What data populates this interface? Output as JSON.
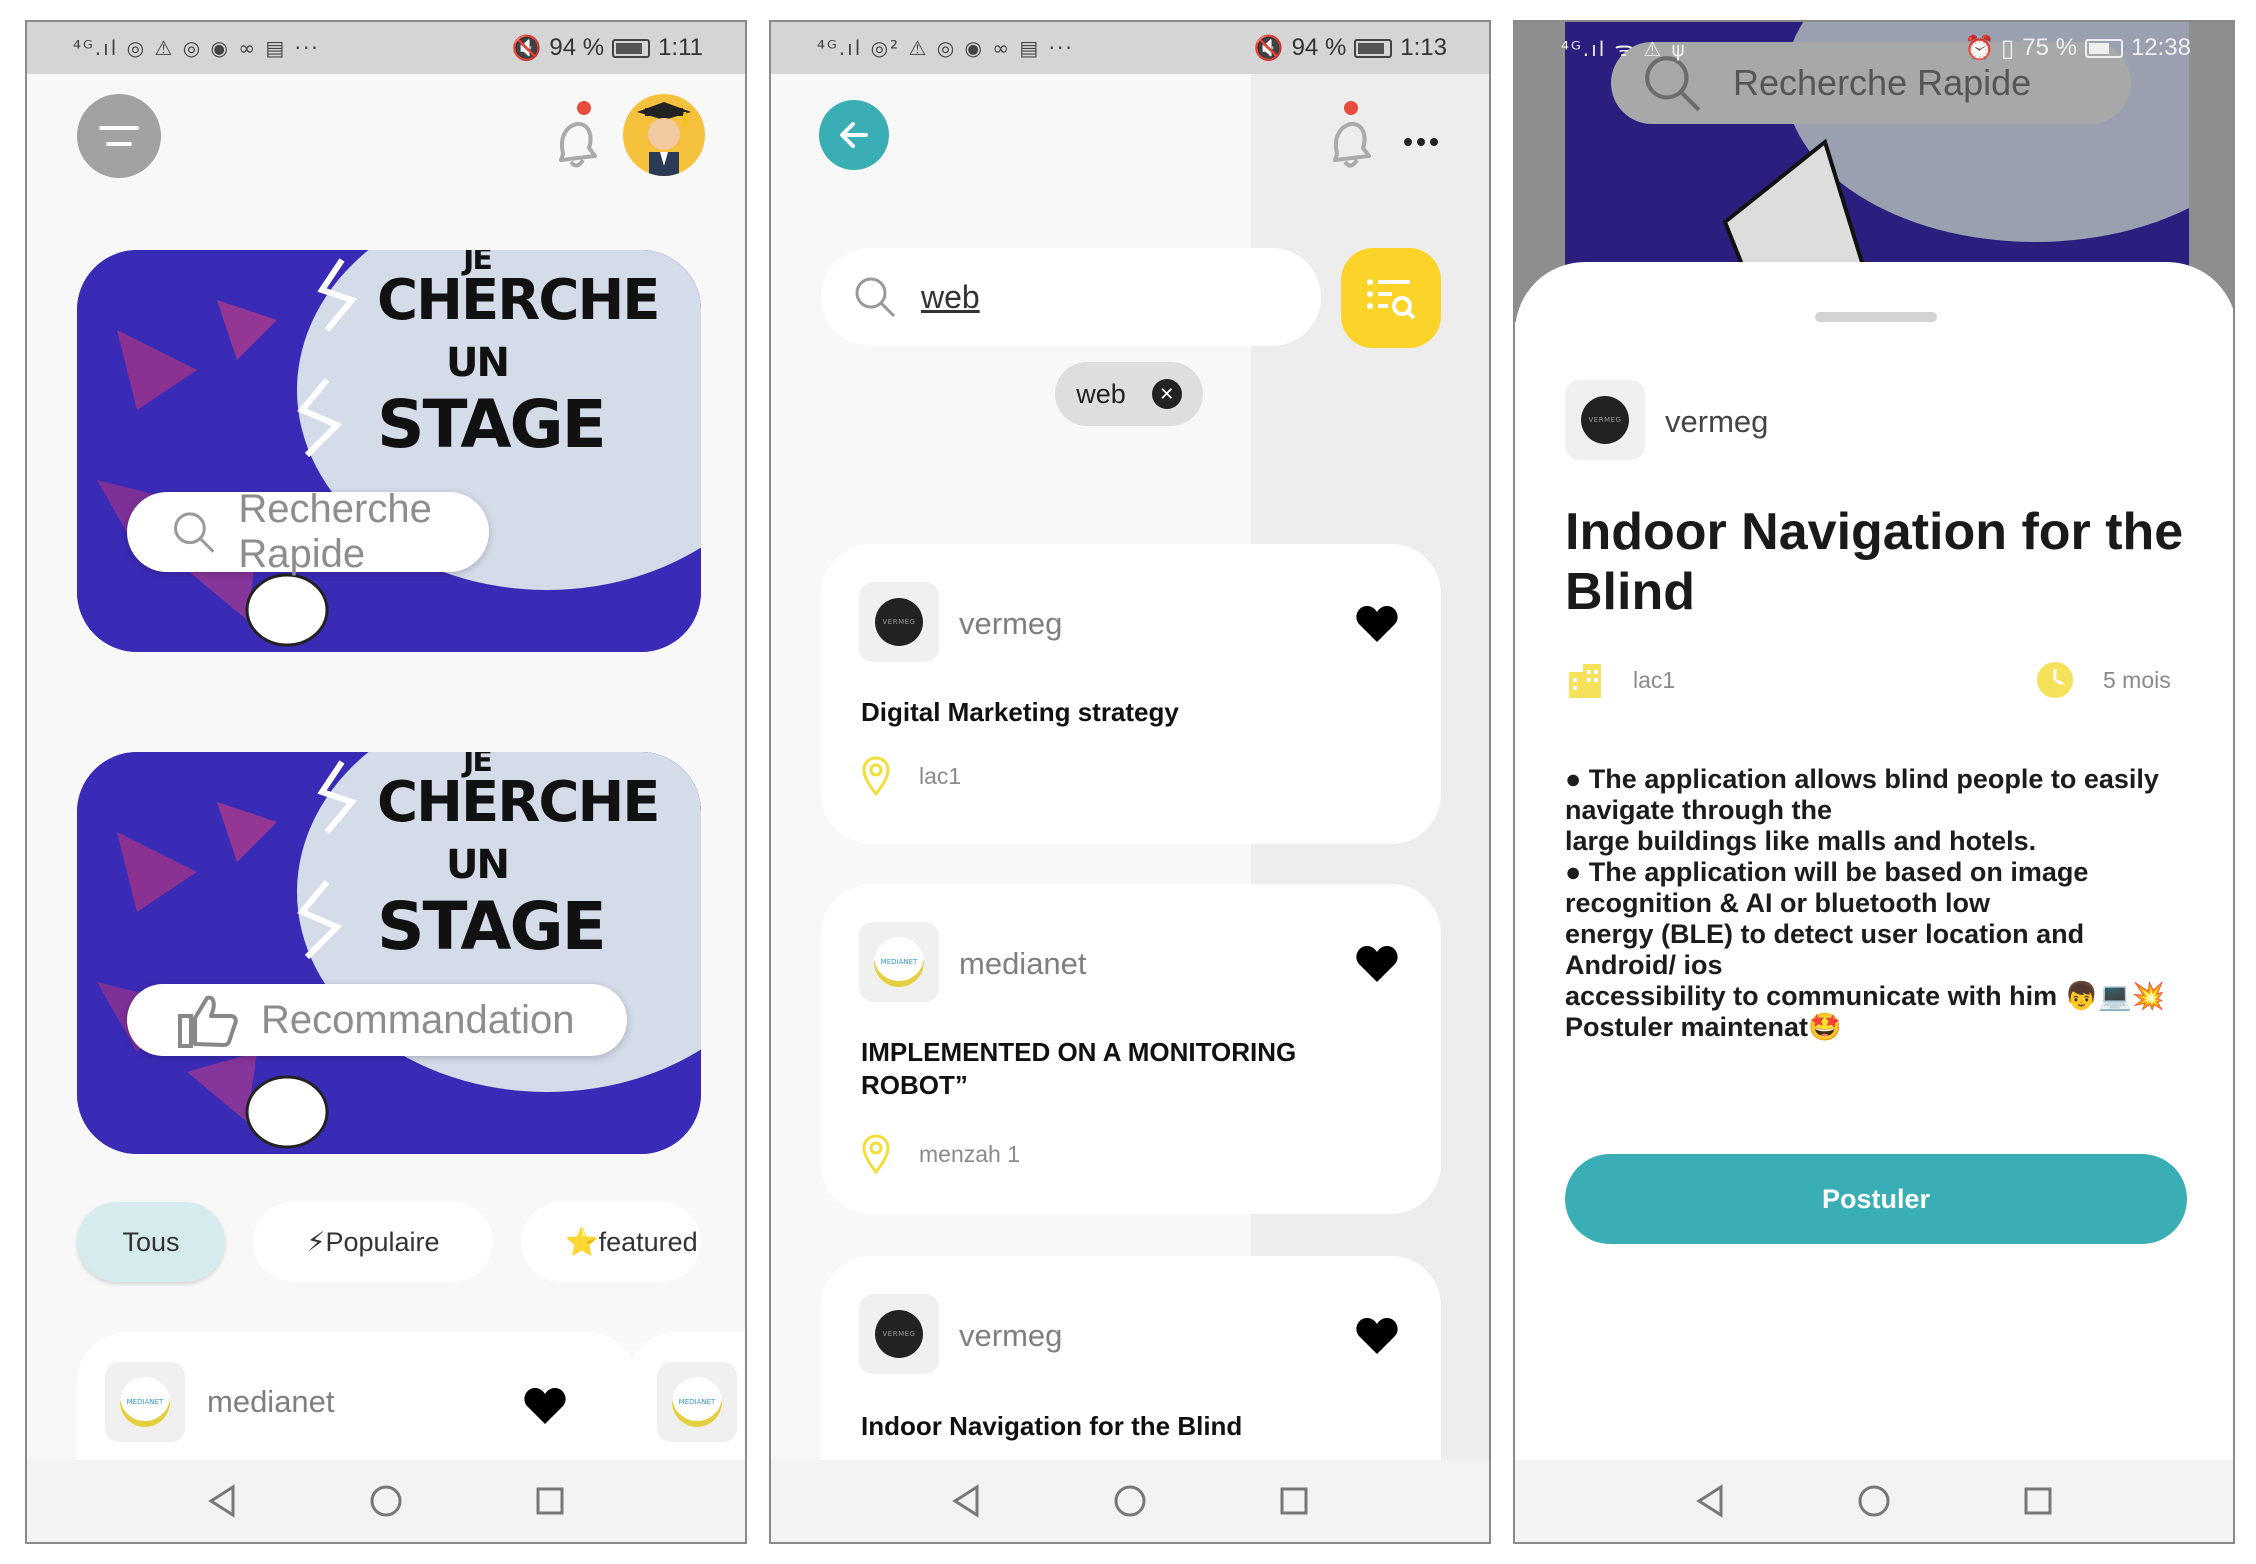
{
  "screens": [
    {
      "status": {
        "icons_left": "⁴ᴳ.ıl ◎ ⚠ ◎ ◉ ∞ ▤ ···",
        "battery": "94 %",
        "time": "1:11"
      },
      "banner_text": [
        "JE",
        "CHERCHE",
        "UN",
        "STAGE"
      ],
      "quick_search_label": "Recherche Rapide",
      "recommend_label": "Recommandation",
      "filters": [
        {
          "label": "Tous",
          "icon": ""
        },
        {
          "label": "Populaire",
          "icon": "⚡"
        },
        {
          "label": "featured",
          "icon": "⭐"
        }
      ],
      "preview_card": {
        "company": "medianet",
        "logo_text": "MEDIANET"
      }
    },
    {
      "status": {
        "icons_left": "⁴ᴳ.ıl ◎² ⚠ ◎ ◉ ∞ ▤ ···",
        "battery": "94 %",
        "time": "1:13"
      },
      "search_value": "web",
      "active_tag": "web",
      "results": [
        {
          "company": "vermeg",
          "logo_text": "VERMEG",
          "title": "Digital Marketing strategy",
          "location": "lac1"
        },
        {
          "company": "medianet",
          "logo_text": "MEDIANET",
          "title": "IMPLEMENTED ON A MONITORING ROBOT”",
          "location": "menzah 1"
        },
        {
          "company": "vermeg",
          "logo_text": "VERMEG",
          "title": "Indoor Navigation for the Blind",
          "location": ""
        }
      ]
    },
    {
      "status": {
        "icons_left": "⁴ᴳ.ıl ᯤ ⚠ ψ",
        "right_icons": "⏰ ▯",
        "battery": "75 %",
        "time": "12:38"
      },
      "bg_search_label": "Recherche Rapide",
      "company": "vermeg",
      "logo_text": "VERMEG",
      "title": "Indoor Navigation for the Blind",
      "location": "lac1",
      "duration": "5 mois",
      "description": [
        "● The application allows blind people to easily navigate through the",
        "large buildings like malls and hotels.",
        "● The application will be based on image recognition & AI or bluetooth low",
        "energy (BLE) to detect user location and Android/ ios",
        "accessibility to communicate with him 👦💻💥",
        "Postuler maintenat🤩"
      ],
      "apply_label": "Postuler"
    }
  ],
  "colors": {
    "teal": "#3aaeb5",
    "yellow": "#fcd429",
    "banner_blue": "#3a2bb6"
  }
}
